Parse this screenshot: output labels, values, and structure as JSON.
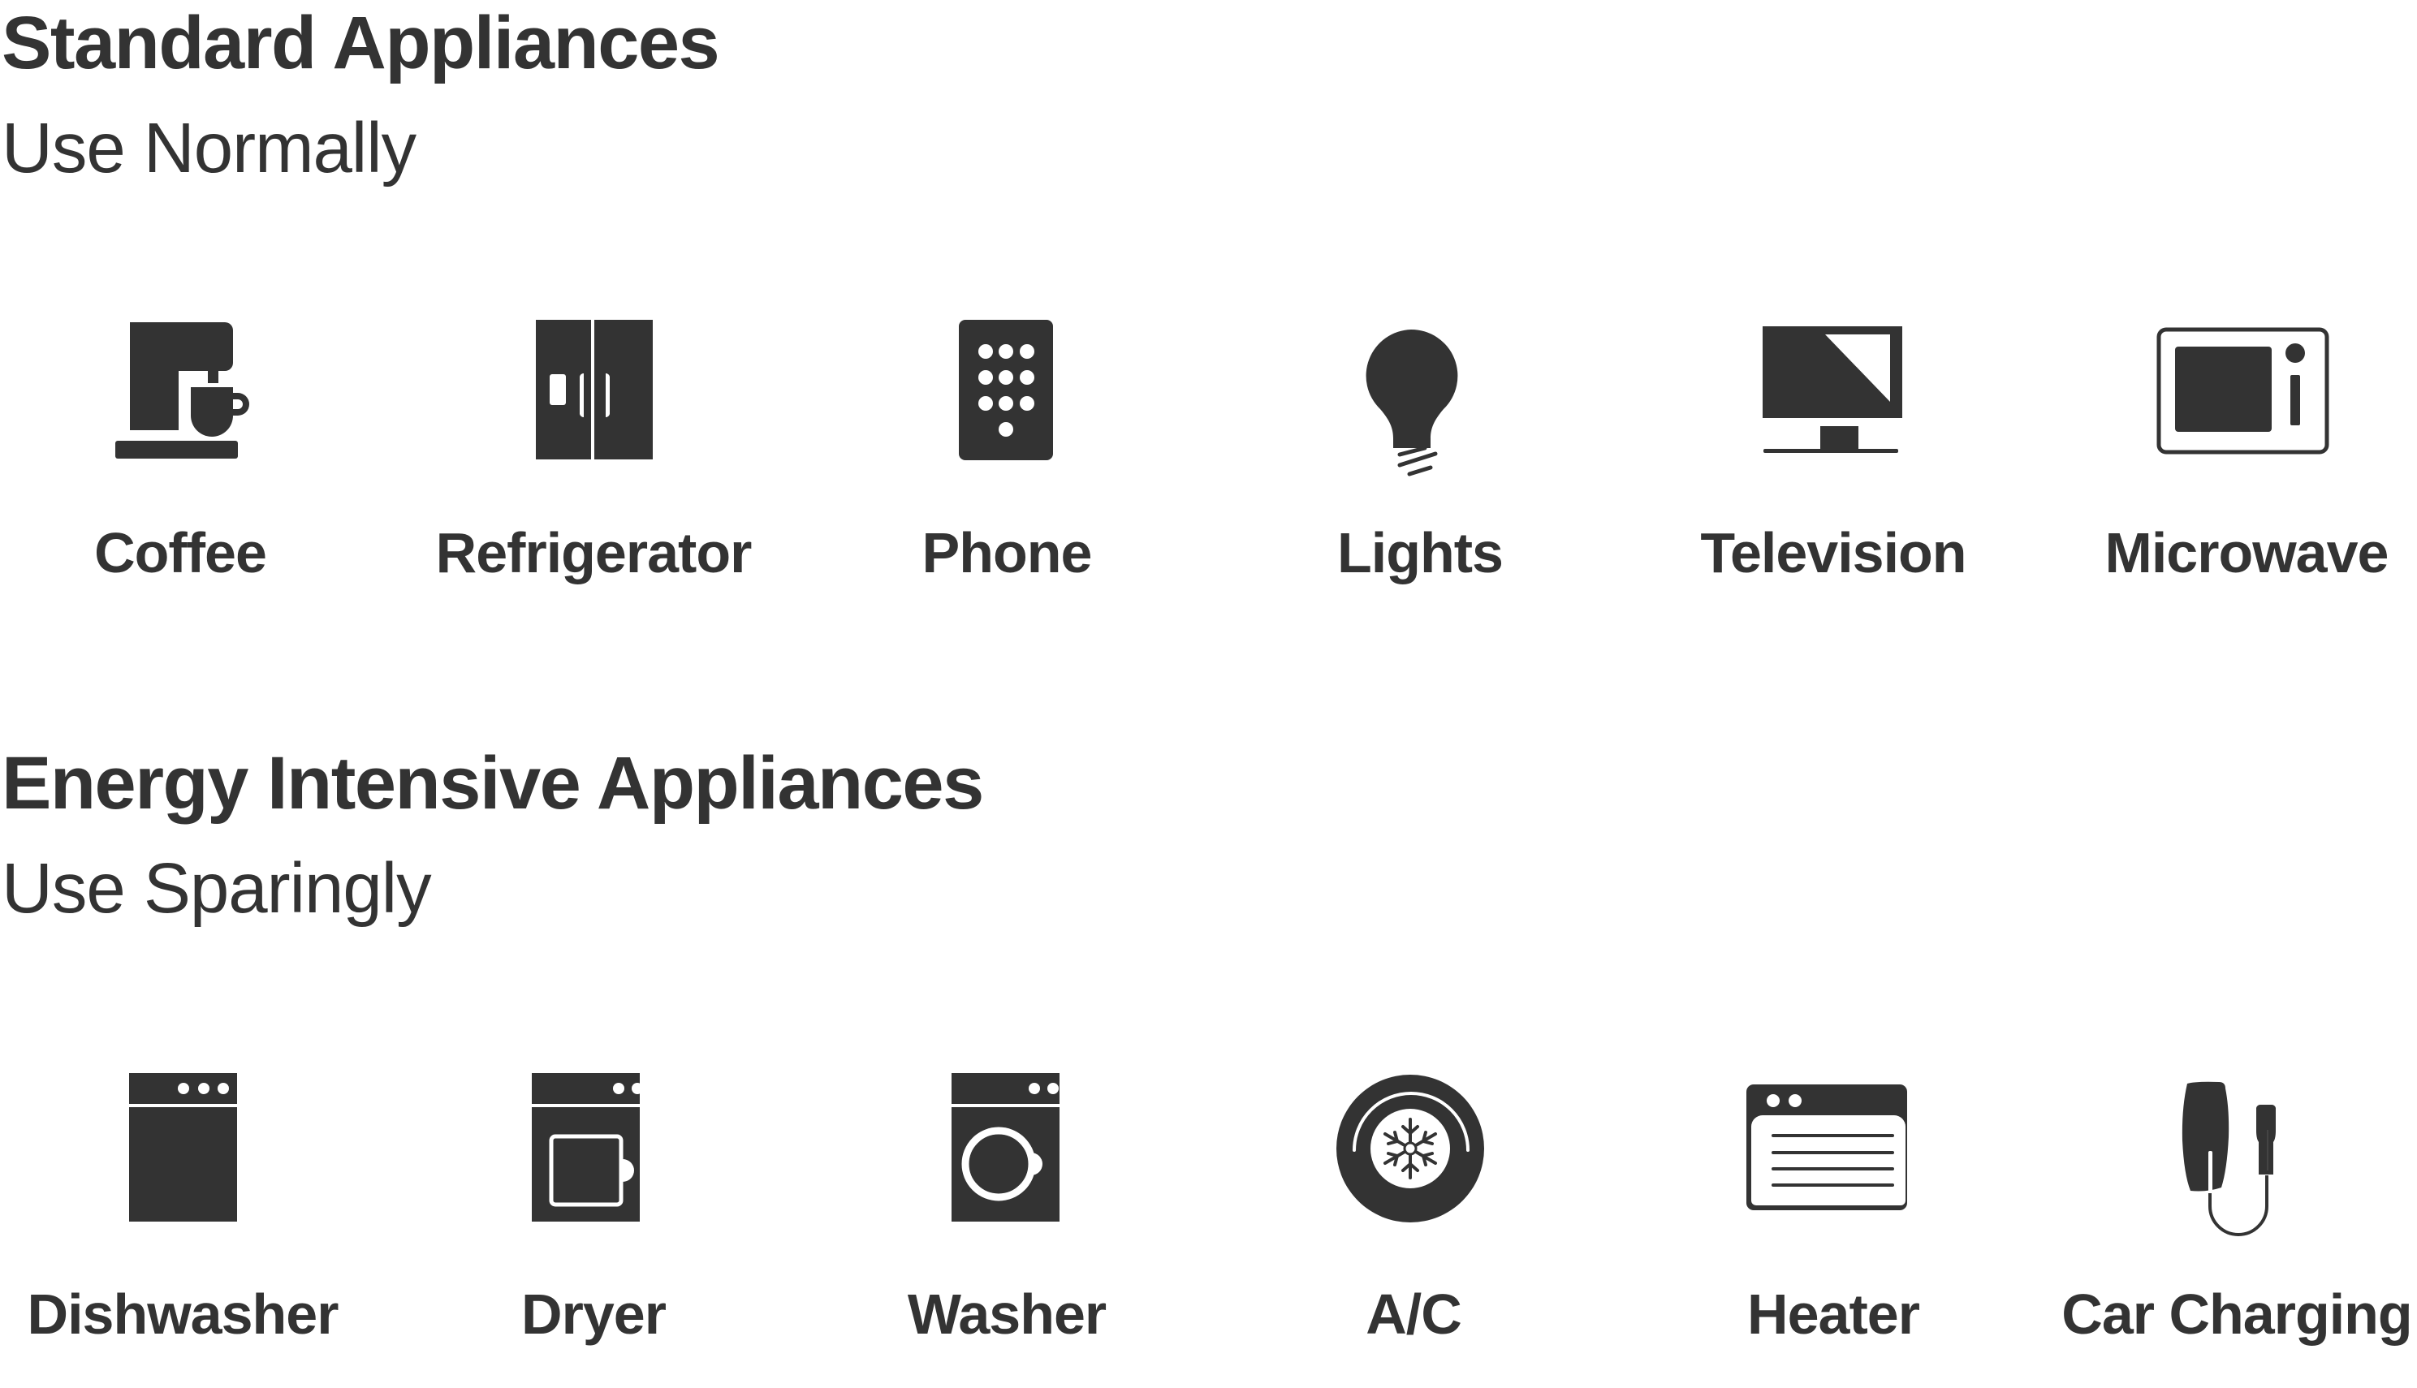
{
  "sections": [
    {
      "title": "Standard Appliances",
      "subtitle": "Use Normally",
      "items": [
        {
          "label": "Coffee",
          "icon": "coffee-maker-icon"
        },
        {
          "label": "Refrigerator",
          "icon": "refrigerator-icon"
        },
        {
          "label": "Phone",
          "icon": "phone-icon"
        },
        {
          "label": "Lights",
          "icon": "lightbulb-icon"
        },
        {
          "label": "Television",
          "icon": "television-icon"
        },
        {
          "label": "Microwave",
          "icon": "microwave-icon"
        }
      ]
    },
    {
      "title": "Energy Intensive Appliances",
      "subtitle": "Use Sparingly",
      "items": [
        {
          "label": "Dishwasher",
          "icon": "dishwasher-icon"
        },
        {
          "label": "Dryer",
          "icon": "dryer-icon"
        },
        {
          "label": "Washer",
          "icon": "washer-icon"
        },
        {
          "label": "A/C",
          "icon": "air-conditioner-icon"
        },
        {
          "label": "Heater",
          "icon": "heater-icon"
        },
        {
          "label": "Car Charging",
          "icon": "car-charger-icon"
        }
      ]
    }
  ],
  "colors": {
    "text": "#333333",
    "icon": "#333333",
    "background": "#ffffff"
  }
}
